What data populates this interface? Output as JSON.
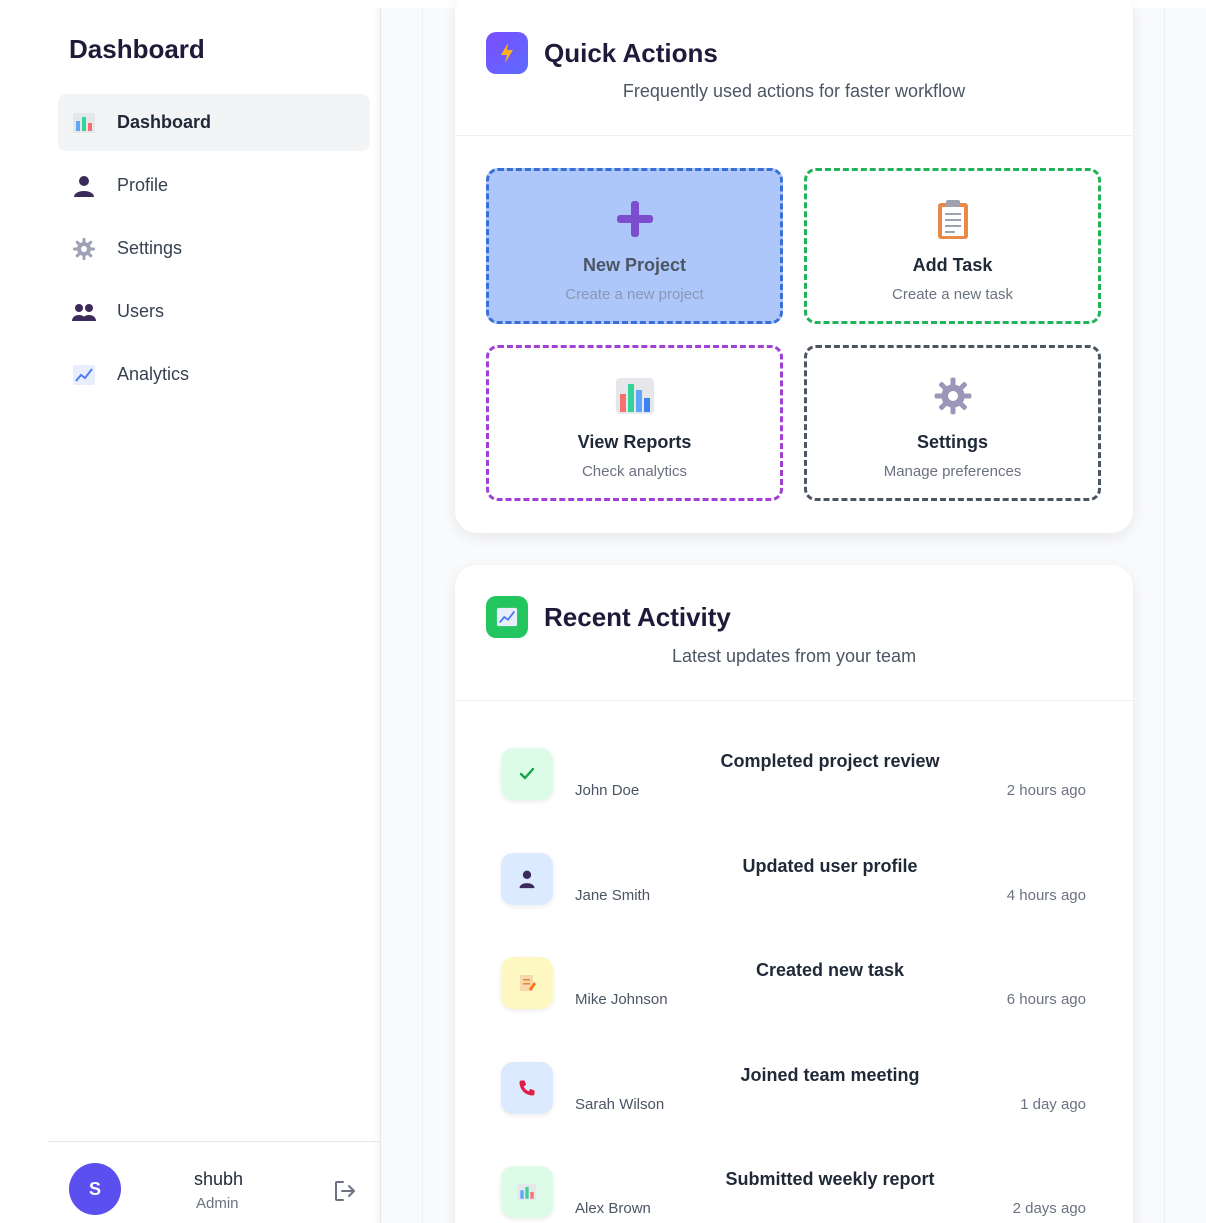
{
  "sidebar": {
    "title": "Dashboard",
    "items": [
      {
        "label": "Dashboard",
        "icon": "bar-chart-icon",
        "active": true
      },
      {
        "label": "Profile",
        "icon": "user-icon"
      },
      {
        "label": "Settings",
        "icon": "gear-icon"
      },
      {
        "label": "Users",
        "icon": "users-icon"
      },
      {
        "label": "Analytics",
        "icon": "line-chart-icon"
      }
    ],
    "user": {
      "initial": "S",
      "name": "shubh",
      "role": "Admin"
    }
  },
  "quick_actions": {
    "title": "Quick Actions",
    "subtitle": "Frequently used actions for faster workflow",
    "tiles": [
      {
        "title": "New Project",
        "subtitle": "Create a new project",
        "icon": "plus-icon",
        "color": "#3b6fd8"
      },
      {
        "title": "Add Task",
        "subtitle": "Create a new task",
        "icon": "clipboard-icon",
        "color": "#22b35a"
      },
      {
        "title": "View Reports",
        "subtitle": "Check analytics",
        "icon": "bar-chart-icon",
        "color": "#a13fd6"
      },
      {
        "title": "Settings",
        "subtitle": "Manage preferences",
        "icon": "gear-icon",
        "color": "#4b5563"
      }
    ]
  },
  "recent_activity": {
    "title": "Recent Activity",
    "subtitle": "Latest updates from your team",
    "items": [
      {
        "title": "Completed project review",
        "user": "John Doe",
        "time": "2 hours ago",
        "icon": "check-icon",
        "bg": "#dcfce7"
      },
      {
        "title": "Updated user profile",
        "user": "Jane Smith",
        "time": "4 hours ago",
        "icon": "user-icon",
        "bg": "#dbeafe"
      },
      {
        "title": "Created new task",
        "user": "Mike Johnson",
        "time": "6 hours ago",
        "icon": "memo-icon",
        "bg": "#fef9c3"
      },
      {
        "title": "Joined team meeting",
        "user": "Sarah Wilson",
        "time": "1 day ago",
        "icon": "phone-icon",
        "bg": "#dbeafe"
      },
      {
        "title": "Submitted weekly report",
        "user": "Alex Brown",
        "time": "2 days ago",
        "icon": "bar-chart-icon",
        "bg": "#dcfce7"
      }
    ]
  }
}
